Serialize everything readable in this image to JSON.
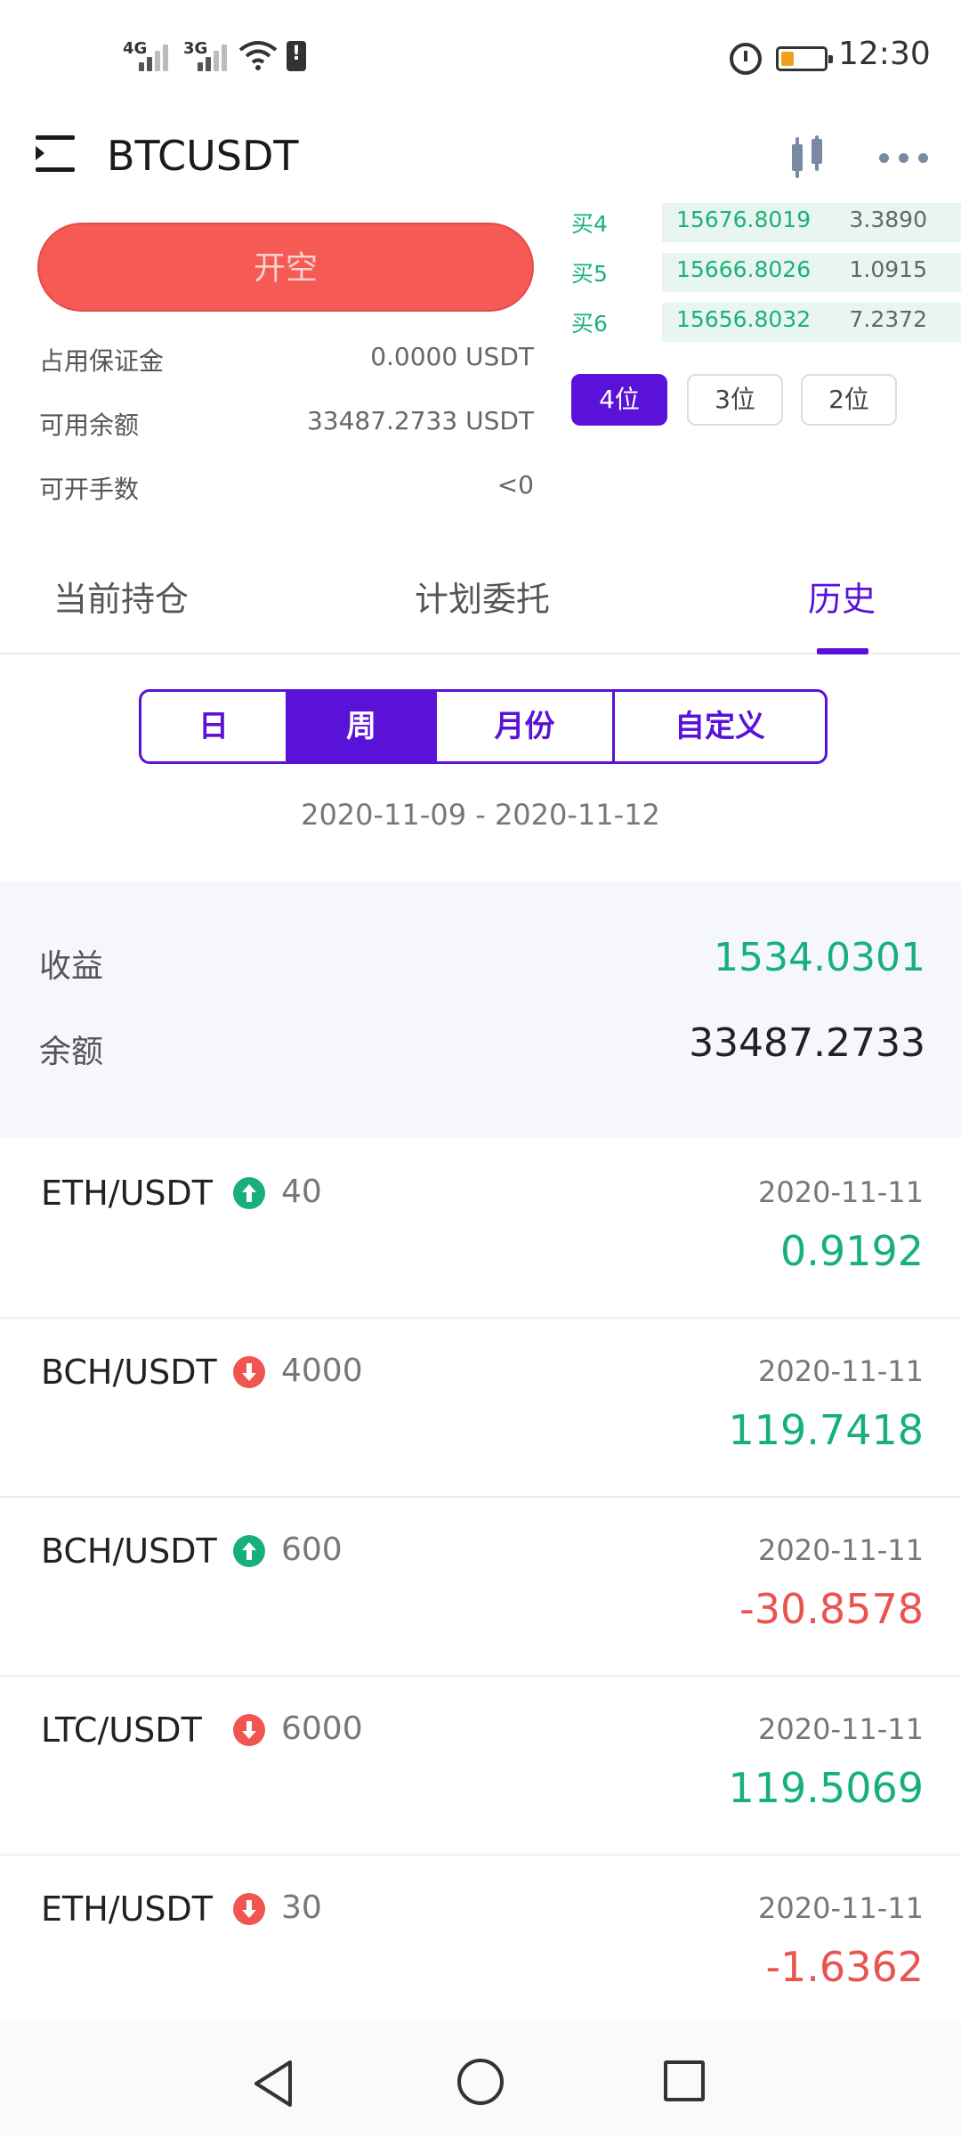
{
  "status_bar": {
    "net1": "4G",
    "net2": "3G",
    "time": "12:30"
  },
  "header": {
    "symbol": "BTCUSDT"
  },
  "trade_panel": {
    "open_short_label": "开空",
    "margin_label": "占用保证金",
    "margin_value": "0.0000 USDT",
    "available_label": "可用余额",
    "available_value": "33487.2733 USDT",
    "openable_label": "可开手数",
    "openable_value": "<0"
  },
  "order_book": {
    "rows": [
      {
        "level": "买4",
        "price": "15676.8019",
        "qty": "3.3890"
      },
      {
        "level": "买5",
        "price": "15666.8026",
        "qty": "1.0915"
      },
      {
        "level": "买6",
        "price": "15656.8032",
        "qty": "7.2372"
      }
    ],
    "precision": [
      "4位",
      "3位",
      "2位"
    ]
  },
  "tabs": [
    "当前持仓",
    "计划委托",
    "历史"
  ],
  "periods": [
    "日",
    "周",
    "月份",
    "自定义"
  ],
  "date_range": "2020-11-09 - 2020-11-12",
  "summary": {
    "profit_label": "收益",
    "profit_value": "1534.0301",
    "balance_label": "余额",
    "balance_value": "33487.2733"
  },
  "history": [
    {
      "pair": "ETH/USDT",
      "direction": "up",
      "qty": "40",
      "date": "2020-11-11",
      "pnl": "0.9192"
    },
    {
      "pair": "BCH/USDT",
      "direction": "down",
      "qty": "4000",
      "date": "2020-11-11",
      "pnl": "119.7418"
    },
    {
      "pair": "BCH/USDT",
      "direction": "up",
      "qty": "600",
      "date": "2020-11-11",
      "pnl": "-30.8578"
    },
    {
      "pair": "LTC/USDT",
      "direction": "down",
      "qty": "6000",
      "date": "2020-11-11",
      "pnl": "119.5069"
    },
    {
      "pair": "ETH/USDT",
      "direction": "down",
      "qty": "30",
      "date": "2020-11-11",
      "pnl": "-1.6362"
    }
  ],
  "colors": {
    "accent": "#5a12d8",
    "positive": "#17b07c",
    "negative": "#ea5450",
    "short_button": "#f55a55"
  }
}
